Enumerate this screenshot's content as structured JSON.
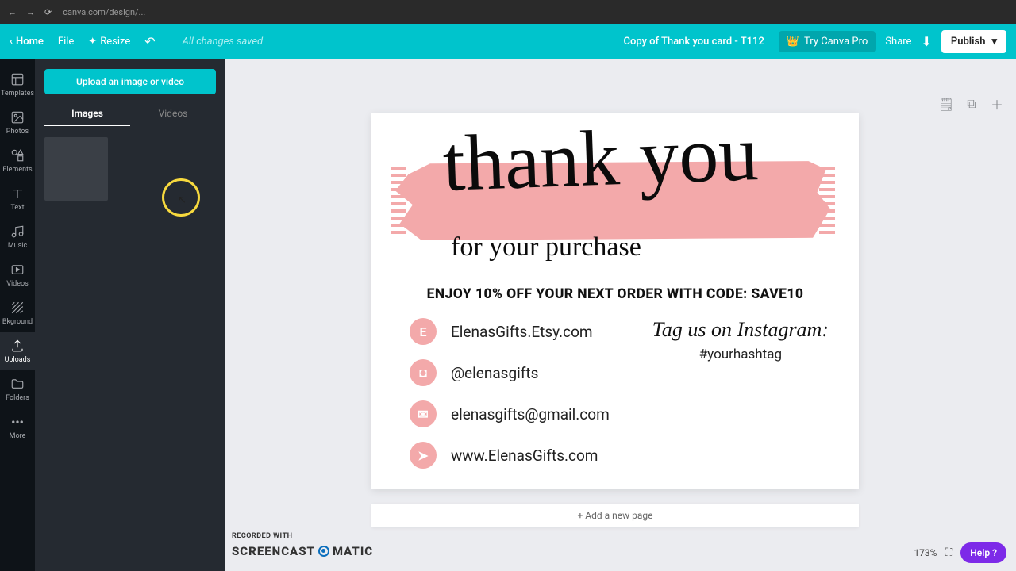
{
  "browser": {
    "url": "canva.com/design/..."
  },
  "toolbar": {
    "home": "Home",
    "file": "File",
    "resize": "Resize",
    "status": "All changes saved",
    "doc_title": "Copy of Thank you card - T112",
    "try_pro": "Try Canva Pro",
    "share": "Share",
    "publish": "Publish"
  },
  "rail": {
    "templates": "Templates",
    "photos": "Photos",
    "elements": "Elements",
    "text": "Text",
    "music": "Music",
    "videos": "Videos",
    "background": "Bkground",
    "uploads": "Uploads",
    "folders": "Folders",
    "more": "More"
  },
  "panel": {
    "upload": "Upload an image or video",
    "tab_images": "Images",
    "tab_videos": "Videos"
  },
  "card": {
    "thank_you": "thank you",
    "subtitle": "for your purchase",
    "promo": "ENJOY 10% OFF YOUR NEXT ORDER WITH CODE: SAVE10",
    "contacts": {
      "etsy": "ElenasGifts.Etsy.com",
      "instagram": "@elenasgifts",
      "email": "elenasgifts@gmail.com",
      "web": "www.ElenasGifts.com"
    },
    "tag_title": "Tag us on Instagram:",
    "tag_hash": "#yourhashtag"
  },
  "add_page": "+ Add a new page",
  "footer": {
    "zoom": "173%",
    "help": "Help ?"
  },
  "watermark": {
    "line1": "RECORDED WITH",
    "brand1": "SCREENCAST",
    "brand2": "MATIC"
  },
  "colors": {
    "brand_cyan": "#00c4cc",
    "pink": "#f3a9aa",
    "purple": "#7d2ae8"
  }
}
